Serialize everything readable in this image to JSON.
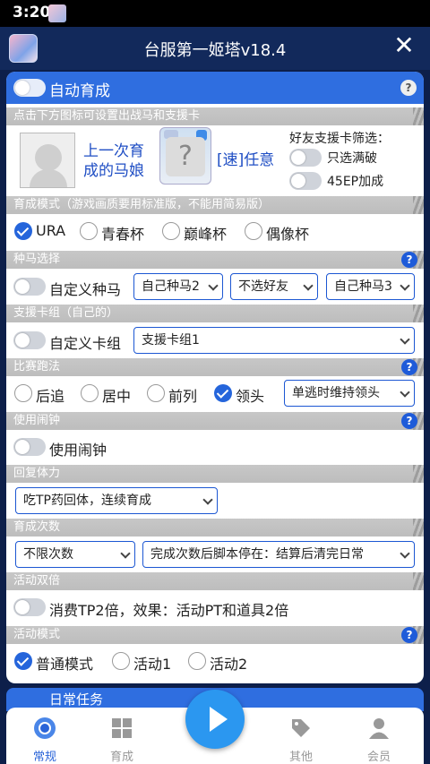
{
  "status": {
    "time": "3:20"
  },
  "app": {
    "title": "台服第一姬塔v18.4"
  },
  "auto": {
    "label": "自动育成"
  },
  "sections": {
    "setup": "点击下方图标可设置出战马和支援卡",
    "mode": "育成模式（游戏画质要用标准版，不能用简易版）",
    "breed": "种马选择",
    "cards": "支援卡组（自己的）",
    "strategy": "比赛跑法",
    "alarm": "使用闹钟",
    "stamina": "回复体力",
    "count": "育成次数",
    "event": "活动双倍",
    "eventmode": "活动模式"
  },
  "setup": {
    "last_horse": "上一次育成的马娘",
    "card_label": "[速]任意",
    "filter_title": "好友支援卡筛选：",
    "filter_full": "只选满破",
    "filter_45ep": "45EP加成"
  },
  "mode": {
    "options": [
      "URA",
      "青春杯",
      "巅峰杯",
      "偶像杯"
    ],
    "selected": "URA"
  },
  "breed": {
    "custom": "自定义种马",
    "selects": [
      "自己种马2",
      "不选好友",
      "自己种马3"
    ]
  },
  "cards": {
    "custom": "自定义卡组",
    "select": "支援卡组1"
  },
  "strategy": {
    "options": [
      "后追",
      "居中",
      "前列",
      "领头"
    ],
    "selected": "领头",
    "select": "单逃时维持领头"
  },
  "alarm": {
    "label": "使用闹钟"
  },
  "stamina": {
    "select": "吃TP药回体，连续育成"
  },
  "count": {
    "select1": "不限次数",
    "select2": "完成次数后脚本停在：结算后清完日常"
  },
  "event": {
    "label": "消费TP2倍，效果：活动PT和道具2倍"
  },
  "eventmode": {
    "options": [
      "普通模式",
      "活动1",
      "活动2"
    ],
    "selected": "普通模式"
  },
  "next_section": {
    "label": "日常任务"
  },
  "nav": {
    "items": [
      "常规",
      "育成",
      "其他",
      "会员"
    ],
    "active": "常规"
  },
  "colors": {
    "accent": "#2f6ee0",
    "header": "#12295b",
    "section": "#c4c4c4"
  }
}
